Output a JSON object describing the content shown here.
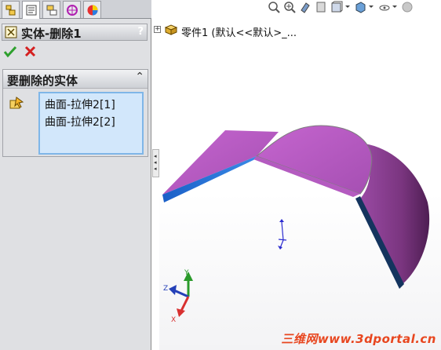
{
  "panel": {
    "tabs": [
      {
        "name": "feature-manager-icon"
      },
      {
        "name": "property-manager-icon"
      },
      {
        "name": "configuration-manager-icon"
      },
      {
        "name": "dimxpert-icon"
      },
      {
        "name": "display-manager-icon"
      }
    ],
    "title": "实体-删除1",
    "help": "?",
    "group": {
      "title": "要删除的实体",
      "collapse": "⌃",
      "items": [
        "曲面-拉伸2[1]",
        "曲面-拉伸2[2]"
      ]
    }
  },
  "graphics": {
    "tree_label": "零件1  (默认<<默认>_...",
    "tree_expand": "+",
    "triad": {
      "x": "X",
      "y": "Y",
      "z": "Z"
    },
    "toolbar_icons": [
      "zoom-to-fit-icon",
      "zoom-to-area-icon",
      "previous-view-icon",
      "section-view-icon",
      "view-orientation-icon",
      "display-style-icon",
      "hide-show-items-icon",
      "appearance-icon"
    ]
  },
  "watermark": "三维网www.3dportal.cn",
  "colors": {
    "surface_face": "#b45bc0",
    "surface_dark": "#6a2a6e",
    "surface_edge_blue": "#1f67c4",
    "selection_box": "#d2e7fb"
  }
}
